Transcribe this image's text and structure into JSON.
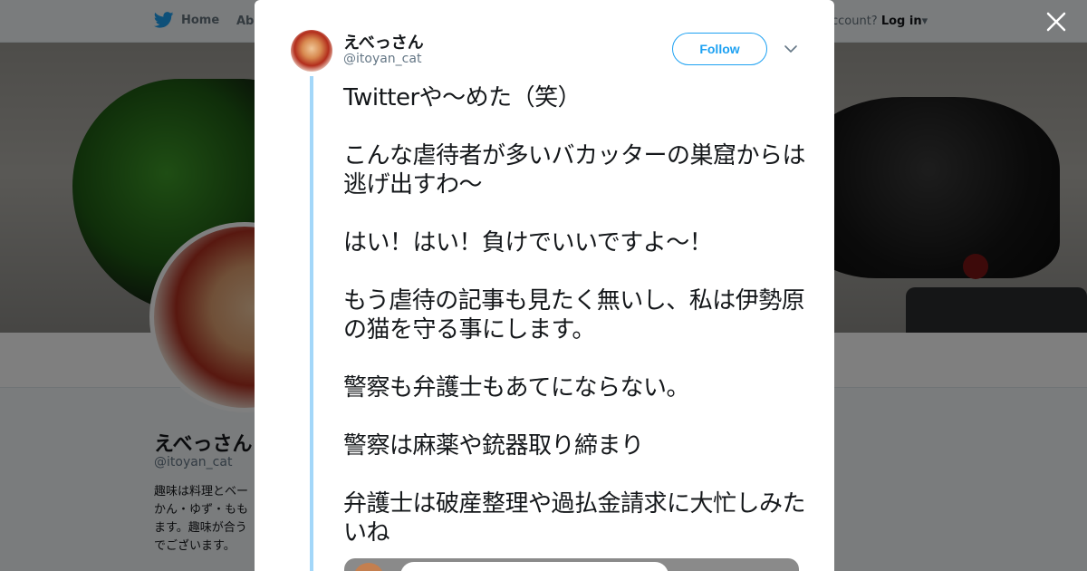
{
  "nav": {
    "home_label": "Home",
    "about_label": "Abo",
    "login_prompt": "account?",
    "login_label": "Log in"
  },
  "profile": {
    "name": "えべっさん",
    "handle": "@itoyan_cat",
    "bio": "趣味は料理とベーかん・ゆず・ももます。趣味が合うでございます。"
  },
  "tweet": {
    "author_name": "えべっさん",
    "author_handle": "@itoyan_cat",
    "follow_label": "Follow",
    "text": "Twitterや〜めた（笑）\n\nこんな虐待者が多いバカッターの巣窟からは逃げ出すわ〜\n\nはい！はい！負けでいいですよ〜！\n\nもう虐待の記事も見たく無いし、私は伊勢原の猫を守る事にします。\n\n警察も弁護士もあてにならない。\n\n警察は麻薬や銃器取り締まり\n\n弁護士は破産整理や過払金請求に大忙しみたいね"
  },
  "colors": {
    "twitter_blue": "#1da1f2",
    "thread_line": "#a3d7f9",
    "text_primary": "#14171a",
    "text_secondary": "#657786"
  },
  "icons": {
    "home": "twitter-bird-icon",
    "close": "close-icon",
    "caret": "chevron-down-icon"
  }
}
